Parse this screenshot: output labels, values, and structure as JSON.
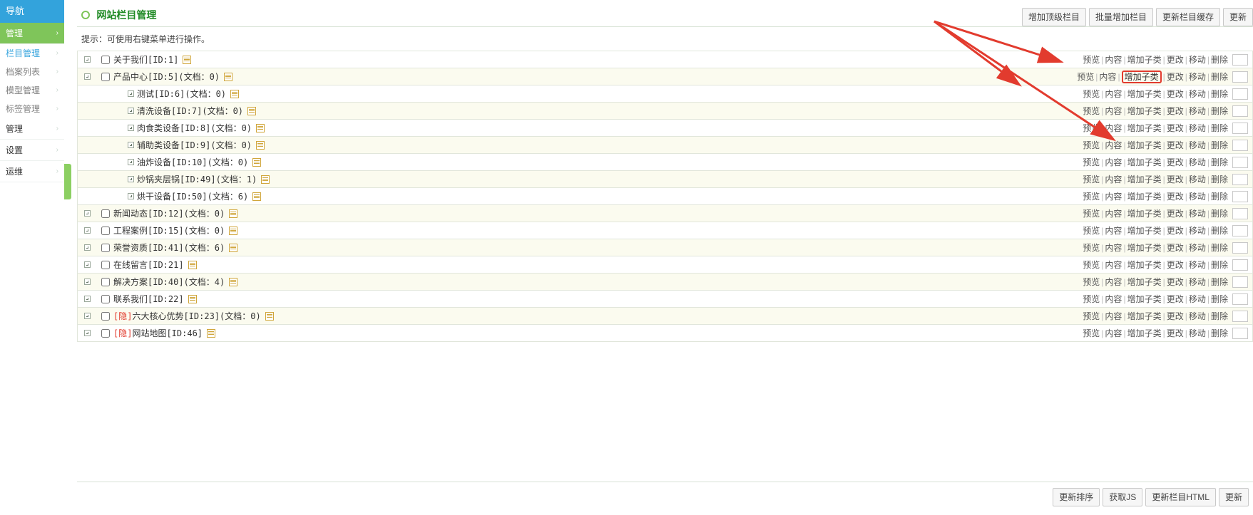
{
  "sidebar": {
    "groups": [
      {
        "label": "导航",
        "type": "head"
      },
      {
        "label": "管理",
        "type": "active"
      },
      {
        "label": "栏目管理",
        "type": "sub",
        "selected": true
      },
      {
        "label": "档案列表",
        "type": "sub"
      },
      {
        "label": "模型管理",
        "type": "sub"
      },
      {
        "label": "标签管理",
        "type": "sub"
      },
      {
        "label": "管理",
        "type": "row"
      },
      {
        "label": "设置",
        "type": "row"
      },
      {
        "label": "运维",
        "type": "row"
      }
    ]
  },
  "header": {
    "title": "网站栏目管理",
    "buttons": [
      "增加顶级栏目",
      "批量增加栏目",
      "更新栏目缓存",
      "更新"
    ]
  },
  "tip": "提示：可使用右键菜单进行操作。",
  "actions": [
    "预览",
    "内容",
    "增加子类",
    "更改",
    "移动",
    "删除"
  ],
  "rows": [
    {
      "indent": 0,
      "exp": true,
      "hidden": false,
      "text": "关于我们[ID:1]",
      "doc": true,
      "alt": false,
      "hl": -1
    },
    {
      "indent": 0,
      "exp": true,
      "hidden": false,
      "text": "产品中心[ID:5](文档：0)",
      "doc": true,
      "alt": true,
      "hl": 2
    },
    {
      "indent": 1,
      "exp": true,
      "hidden": false,
      "text": "测试[ID:6](文档：0)",
      "doc": true,
      "alt": false,
      "hl": -1
    },
    {
      "indent": 1,
      "exp": true,
      "hidden": false,
      "text": "清洗设备[ID:7](文档：0)",
      "doc": true,
      "alt": true,
      "hl": -1
    },
    {
      "indent": 1,
      "exp": true,
      "hidden": false,
      "text": "肉食类设备[ID:8](文档：0)",
      "doc": true,
      "alt": false,
      "hl": -1
    },
    {
      "indent": 1,
      "exp": true,
      "hidden": false,
      "text": "辅助类设备[ID:9](文档：0)",
      "doc": true,
      "alt": true,
      "hl": -1
    },
    {
      "indent": 1,
      "exp": true,
      "hidden": false,
      "text": "油炸设备[ID:10](文档：0)",
      "doc": true,
      "alt": false,
      "hl": -1
    },
    {
      "indent": 1,
      "exp": true,
      "hidden": false,
      "text": "炒锅夹层锅[ID:49](文档：1)",
      "doc": true,
      "alt": true,
      "hl": -1
    },
    {
      "indent": 1,
      "exp": true,
      "hidden": false,
      "text": "烘干设备[ID:50](文档：6)",
      "doc": true,
      "alt": false,
      "hl": -1
    },
    {
      "indent": 0,
      "exp": true,
      "hidden": false,
      "text": "新闻动态[ID:12](文档：0)",
      "doc": true,
      "alt": true,
      "hl": -1
    },
    {
      "indent": 0,
      "exp": true,
      "hidden": false,
      "text": "工程案例[ID:15](文档：0)",
      "doc": true,
      "alt": false,
      "hl": -1
    },
    {
      "indent": 0,
      "exp": true,
      "hidden": false,
      "text": "荣誉资质[ID:41](文档：6)",
      "doc": true,
      "alt": true,
      "hl": -1
    },
    {
      "indent": 0,
      "exp": true,
      "hidden": false,
      "text": "在线留言[ID:21]",
      "doc": true,
      "alt": false,
      "hl": -1
    },
    {
      "indent": 0,
      "exp": true,
      "hidden": false,
      "text": "解决方案[ID:40](文档：4)",
      "doc": true,
      "alt": true,
      "hl": -1
    },
    {
      "indent": 0,
      "exp": true,
      "hidden": false,
      "text": "联系我们[ID:22]",
      "doc": true,
      "alt": false,
      "hl": -1
    },
    {
      "indent": 0,
      "exp": true,
      "hidden": true,
      "text": "六大核心优势[ID:23](文档：0)",
      "doc": true,
      "alt": true,
      "hl": -1
    },
    {
      "indent": 0,
      "exp": true,
      "hidden": true,
      "text": "网站地图[ID:46]",
      "doc": true,
      "alt": false,
      "hl": -1
    }
  ],
  "hidden_tag": "[隐]",
  "footer": {
    "buttons": [
      "更新排序",
      "获取JS",
      "更新栏目HTML",
      "更新"
    ]
  }
}
